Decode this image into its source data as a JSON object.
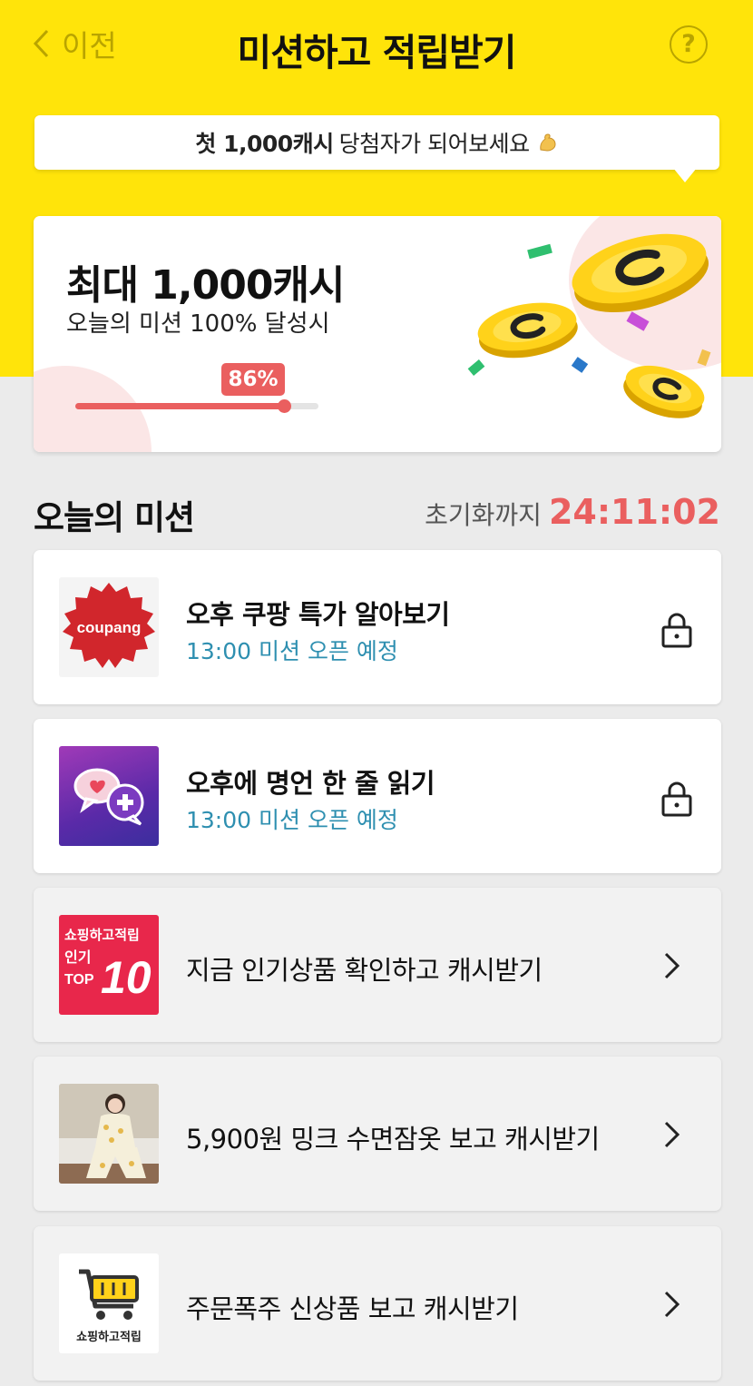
{
  "header": {
    "back_label": "이전",
    "title": "미션하고 적립받기",
    "help_label": "?"
  },
  "promo": {
    "highlight": "첫 1,000캐시",
    "text": "당첨자가 되어보세요"
  },
  "reward": {
    "title": "최대 1,000캐시",
    "subtitle": "오늘의 미션 100% 달성시",
    "progress_label": "86%",
    "progress": 0.86
  },
  "missions_section": {
    "title": "오늘의 미션",
    "reset_label": "초기화까지",
    "reset_time": "24:11:02"
  },
  "missions": [
    {
      "title": "오후 쿠팡 특가 알아보기",
      "status": "13:00 미션 오픈 예정",
      "state": "locked",
      "icon": "coupang-logo",
      "brand": "coupang"
    },
    {
      "title": "오후에 명언 한 줄 읽기",
      "status": "13:00 미션 오픈 예정",
      "state": "locked",
      "icon": "quote-chat-icon"
    },
    {
      "label": "지금 인기상품 확인하고 캐시받기",
      "state": "open",
      "icon": "top10-badge",
      "badge_line1": "쇼핑하고적립",
      "badge_line2": "인기",
      "badge_line3": "TOP",
      "badge_number": "10"
    },
    {
      "label": "5,900원 밍크 수면잠옷 보고 캐시받기",
      "state": "open",
      "icon": "pajama-photo"
    },
    {
      "label": "주문폭주 신상품 보고 캐시받기",
      "state": "open",
      "icon": "shopping-cart-icon",
      "caption": "쇼핑하고적립"
    }
  ],
  "colors": {
    "brand_yellow": "#ffe40a",
    "accent_red": "#ea5f5f",
    "status_blue": "#2e8fb0"
  }
}
